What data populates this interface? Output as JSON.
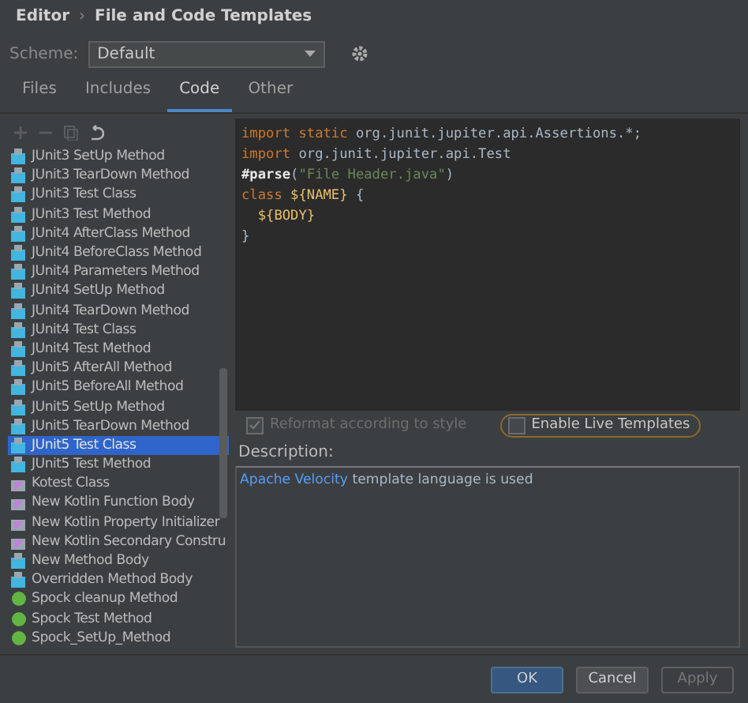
{
  "breadcrumb": [
    {
      "label": "Editor"
    },
    {
      "label": "›",
      "kind": "separator"
    },
    {
      "label": "File and Code Templates"
    }
  ],
  "scheme": {
    "label": "Scheme:",
    "value": "Default"
  },
  "tabs": [
    {
      "label": "Files",
      "selected": false
    },
    {
      "label": "Includes",
      "selected": false
    },
    {
      "label": "Code",
      "selected": true
    },
    {
      "label": "Other",
      "selected": false
    }
  ],
  "toolbar": [
    {
      "kind": "add",
      "disabled": true
    },
    {
      "kind": "remove",
      "disabled": true
    },
    {
      "kind": "copy",
      "disabled": true
    },
    {
      "kind": "reset",
      "disabled": false
    }
  ],
  "templates": [
    {
      "name": "JUnit3 SetUp Method",
      "kind": "java",
      "selected": false
    },
    {
      "name": "JUnit3 TearDown Method",
      "kind": "java",
      "selected": false
    },
    {
      "name": "JUnit3 Test Class",
      "kind": "java",
      "selected": false
    },
    {
      "name": "JUnit3 Test Method",
      "kind": "java",
      "selected": false
    },
    {
      "name": "JUnit4 AfterClass Method",
      "kind": "java",
      "selected": false
    },
    {
      "name": "JUnit4 BeforeClass Method",
      "kind": "java",
      "selected": false
    },
    {
      "name": "JUnit4 Parameters Method",
      "kind": "java",
      "selected": false
    },
    {
      "name": "JUnit4 SetUp Method",
      "kind": "java",
      "selected": false
    },
    {
      "name": "JUnit4 TearDown Method",
      "kind": "java",
      "selected": false
    },
    {
      "name": "JUnit4 Test Class",
      "kind": "java",
      "selected": false
    },
    {
      "name": "JUnit4 Test Method",
      "kind": "java",
      "selected": false
    },
    {
      "name": "JUnit5 AfterAll Method",
      "kind": "java",
      "selected": false
    },
    {
      "name": "JUnit5 BeforeAll Method",
      "kind": "java",
      "selected": false
    },
    {
      "name": "JUnit5 SetUp Method",
      "kind": "java",
      "selected": false
    },
    {
      "name": "JUnit5 TearDown Method",
      "kind": "java",
      "selected": false
    },
    {
      "name": "JUnit5 Test Class",
      "kind": "java",
      "selected": true
    },
    {
      "name": "JUnit5 Test Method",
      "kind": "java",
      "selected": false
    },
    {
      "name": "Kotest Class",
      "kind": "kotlin",
      "selected": false
    },
    {
      "name": "New Kotlin Function Body",
      "kind": "kotlin",
      "selected": false
    },
    {
      "name": "New Kotlin Property Initializer",
      "kind": "kotlin",
      "selected": false
    },
    {
      "name": "New Kotlin Secondary Constru",
      "kind": "kotlin",
      "selected": false
    },
    {
      "name": "New Method Body",
      "kind": "java",
      "selected": false
    },
    {
      "name": "Overridden Method Body",
      "kind": "java",
      "selected": false
    },
    {
      "name": "Spock cleanup Method",
      "kind": "groovy",
      "selected": false
    },
    {
      "name": "Spock Test Method",
      "kind": "groovy",
      "selected": false
    },
    {
      "name": "Spock_SetUp_Method",
      "kind": "groovy",
      "selected": false
    }
  ],
  "code": [
    [
      {
        "text": "import static ",
        "kind": "keyword"
      },
      {
        "text": "org.junit.jupiter.api.Assertions.*;",
        "kind": "plain"
      }
    ],
    [
      {
        "text": "import ",
        "kind": "keyword"
      },
      {
        "text": "org.junit.jupiter.api.Test",
        "kind": "plain"
      }
    ],
    [
      {
        "text": "#parse",
        "kind": "directive"
      },
      {
        "text": "(",
        "kind": "plain"
      },
      {
        "text": "\"File Header.java\"",
        "kind": "string"
      },
      {
        "text": ")",
        "kind": "plain"
      }
    ],
    [
      {
        "text": "class ",
        "kind": "keyword"
      },
      {
        "text": "${NAME}",
        "kind": "variable"
      },
      {
        "text": " {",
        "kind": "brace"
      }
    ],
    [
      {
        "text": "  ${BODY}",
        "kind": "variable"
      }
    ],
    [
      {
        "text": "}",
        "kind": "brace"
      }
    ]
  ],
  "options": [
    {
      "label": "Reformat according to style",
      "checked": true,
      "disabled": true,
      "focused": false
    },
    {
      "label": "Enable Live Templates",
      "checked": false,
      "disabled": false,
      "focused": true
    }
  ],
  "description": {
    "label": "Description:",
    "parts": [
      {
        "text": "Apache Velocity",
        "kind": "link"
      },
      {
        "text": " template language is used",
        "kind": "plain"
      }
    ]
  },
  "buttons": [
    {
      "label": "OK",
      "kind": "primary",
      "disabled": false
    },
    {
      "label": "Cancel",
      "kind": "normal",
      "disabled": false
    },
    {
      "label": "Apply",
      "kind": "normal",
      "disabled": true
    }
  ]
}
